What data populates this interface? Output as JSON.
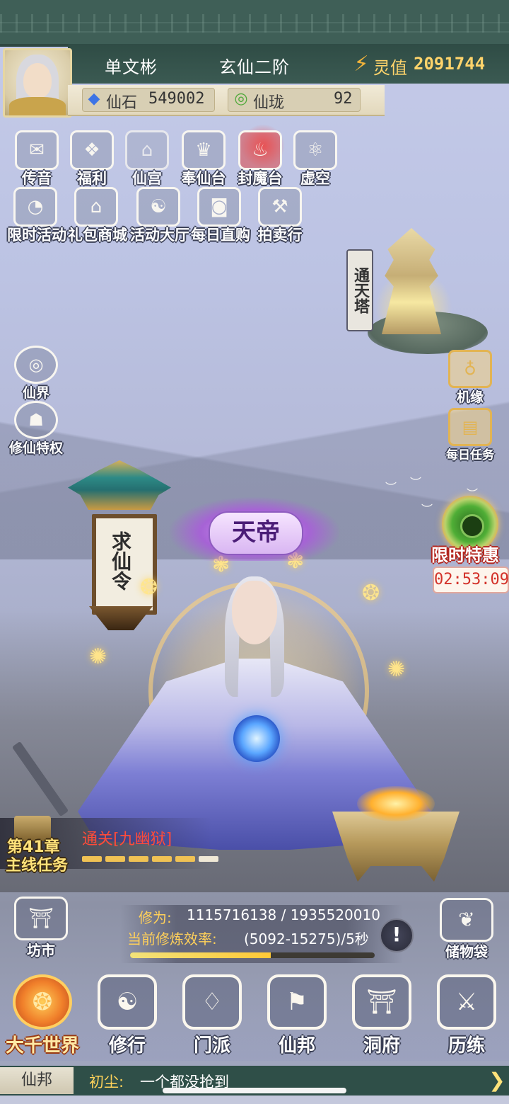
{
  "player": {
    "name": "单文彬",
    "rank": "玄仙二阶",
    "lingzhi_label": "灵值",
    "lingzhi_value": "2091744"
  },
  "resources": [
    {
      "icon": "blue-gem-icon",
      "label": "仙石",
      "value": "549002"
    },
    {
      "icon": "jade-ring-icon",
      "label": "仙珑",
      "value": "92"
    }
  ],
  "top_menu": {
    "row1": [
      {
        "label": "传音",
        "icon": "envelope-icon"
      },
      {
        "label": "福利",
        "icon": "gift-bag-icon"
      },
      {
        "label": "仙宫",
        "icon": "palace-icon"
      },
      {
        "label": "奉仙台",
        "icon": "altar-icon"
      },
      {
        "label": "封魔台",
        "icon": "demon-seal-icon"
      },
      {
        "label": "虚空",
        "icon": "atom-icon"
      }
    ],
    "row2": [
      {
        "label": "限时活动",
        "icon": "shield-clock-icon"
      },
      {
        "label": "礼包商城",
        "icon": "shop-icon"
      },
      {
        "label": "活动大厅",
        "icon": "hall-icon"
      },
      {
        "label": "每日直购",
        "icon": "coin-icon"
      },
      {
        "label": "拍卖行",
        "icon": "gavel-icon"
      }
    ]
  },
  "tower": {
    "label": "通天塔"
  },
  "left_side": [
    {
      "label": "仙界",
      "icon": "cloud-portal-icon"
    },
    {
      "label": "修仙特权",
      "icon": "turtle-icon"
    }
  ],
  "right_side": [
    {
      "label": "机缘",
      "icon": "gourd-icon"
    },
    {
      "label": "每日任务",
      "icon": "scroll-icon"
    }
  ],
  "limited_offer": {
    "label": "限时特惠",
    "timer": "02:53:09"
  },
  "lantern": {
    "text": "求仙令"
  },
  "title_badge": {
    "text": "天帝"
  },
  "quest": {
    "chapter": "第41章",
    "type": "主线任务",
    "goal": "通关[九幽狱]",
    "progress_done": 5,
    "progress_total": 6
  },
  "cultivation": {
    "label": "修为:",
    "value": "1115716138 / 1935520010",
    "progress": 0.576,
    "rate_label": "当前修炼效率:",
    "rate_value": "(5092-15275)/5秒",
    "alert": "!"
  },
  "mid_icons": [
    {
      "label": "坊市",
      "icon": "market-icon"
    },
    {
      "label": "储物袋",
      "icon": "bag-icon"
    }
  ],
  "bottom_nav": [
    {
      "label": "大千世界",
      "icon": "world-swirl-icon",
      "active": true
    },
    {
      "label": "修行",
      "icon": "yin-yang-icon",
      "active": false
    },
    {
      "label": "门派",
      "icon": "sect-icon",
      "active": false
    },
    {
      "label": "仙邦",
      "icon": "banner-icon",
      "active": false
    },
    {
      "label": "洞府",
      "icon": "cave-palace-icon",
      "active": false
    },
    {
      "label": "历练",
      "icon": "sword-trial-icon",
      "active": false
    }
  ],
  "chat": {
    "channel": "仙邦",
    "sender": "初尘:",
    "message": "一个都没抢到"
  },
  "colors": {
    "topbar": "#3f5f57",
    "gold": "#ffd46b",
    "timer_red": "#d3322a",
    "quest_red": "#ff4b3a",
    "active_nav": "#f07f2a"
  }
}
